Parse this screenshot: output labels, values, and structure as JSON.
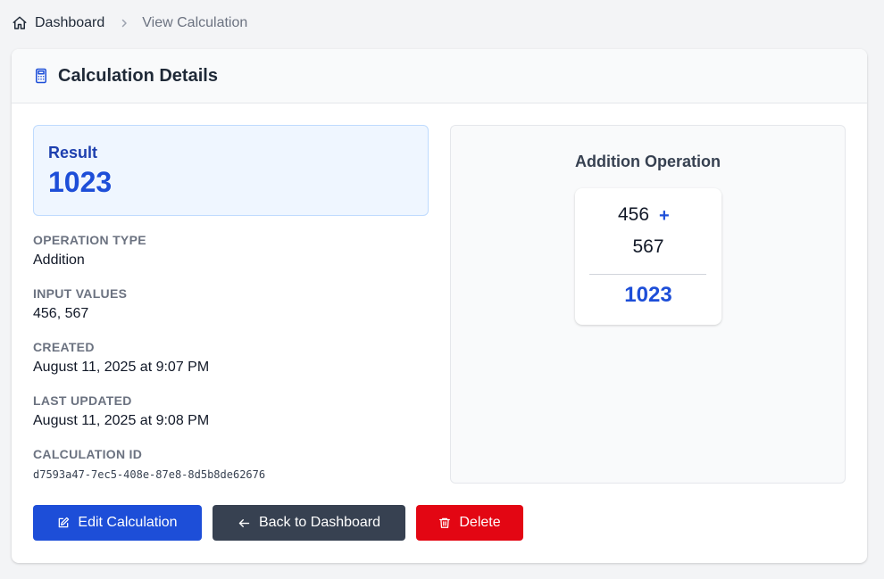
{
  "breadcrumb": {
    "home_label": "Dashboard",
    "current_label": "View Calculation"
  },
  "header": {
    "title": "Calculation Details"
  },
  "result": {
    "label": "Result",
    "value": "1023"
  },
  "fields": [
    {
      "label": "OPERATION TYPE",
      "value": "Addition"
    },
    {
      "label": "INPUT VALUES",
      "value": "456, 567"
    },
    {
      "label": "CREATED",
      "value": "August 11, 2025 at 9:07 PM"
    },
    {
      "label": "LAST UPDATED",
      "value": "August 11, 2025 at 9:08 PM"
    },
    {
      "label": "CALCULATION ID",
      "value": "d7593a47-7ec5-408e-87e8-8d5b8de62676"
    }
  ],
  "visualization": {
    "title": "Addition Operation",
    "operand1": "456",
    "operator": "+",
    "operand2": "567",
    "result": "1023"
  },
  "actions": {
    "edit_label": "Edit Calculation",
    "back_label": "Back to Dashboard",
    "delete_label": "Delete"
  },
  "colors": {
    "primary": "#1d4ed8",
    "secondary": "#374151",
    "danger": "#e30613",
    "result_bg": "#eff6ff"
  },
  "icons": {
    "breadcrumb_home": "home-icon",
    "breadcrumb_separator": "chevron-right-icon",
    "header": "calculator-icon",
    "edit": "edit-icon",
    "back": "arrow-left-icon",
    "delete": "trash-icon"
  }
}
